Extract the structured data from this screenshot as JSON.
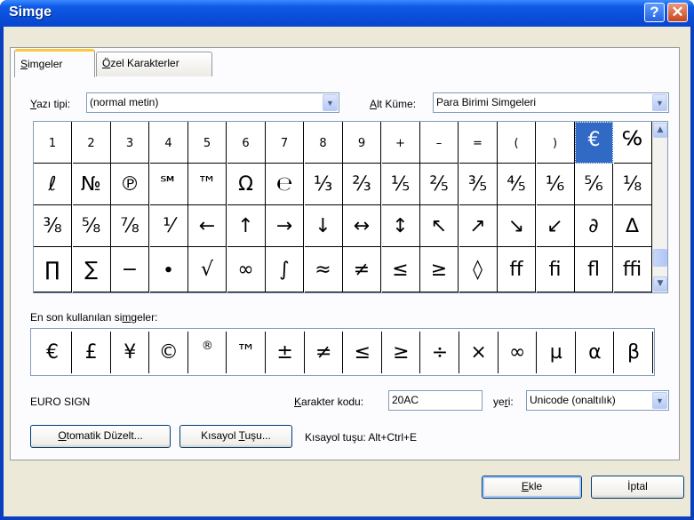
{
  "window": {
    "title": "Simge",
    "help_glyph": "?",
    "close_glyph": "✕"
  },
  "tabs": [
    {
      "label_ul": "S",
      "label_rest": "imgeler"
    },
    {
      "label_ul": "Ö",
      "label_rest": "zel Karakterler"
    }
  ],
  "font": {
    "label_ul": "Y",
    "label_rest": "azı tipi:",
    "value": "(normal metin)"
  },
  "subset": {
    "label_ul": "A",
    "label_rest": "lt Küme:",
    "value": "Para Birimi Simgeleri"
  },
  "symbols": [
    [
      "1",
      "2",
      "3",
      "4",
      "5",
      "6",
      "7",
      "8",
      "9",
      "+",
      "–",
      "=",
      "(",
      ")",
      "€",
      "℅"
    ],
    [
      "ℓ",
      "№",
      "℗",
      "℠",
      "™",
      "Ω",
      "℮",
      "⅓",
      "⅔",
      "⅕",
      "⅖",
      "⅗",
      "⅘",
      "⅙",
      "⅚",
      "⅛"
    ],
    [
      "⅜",
      "⅝",
      "⅞",
      "⅟",
      "←",
      "↑",
      "→",
      "↓",
      "↔",
      "↕",
      "↖",
      "↗",
      "↘",
      "↙",
      "∂",
      "∆"
    ],
    [
      "∏",
      "∑",
      "−",
      "∙",
      "√",
      "∞",
      "∫",
      "≈",
      "≠",
      "≤",
      "≥",
      "◊",
      "ﬀ",
      "ﬁ",
      "ﬂ",
      "ﬃ"
    ]
  ],
  "selected_symbol": {
    "row": 0,
    "col": 14
  },
  "recent_label": {
    "pre": "En son kullanılan si",
    "ul": "m",
    "post": "geler:"
  },
  "recent": [
    "€",
    "£",
    "¥",
    "©",
    "®",
    "™",
    "±",
    "≠",
    "≤",
    "≥",
    "÷",
    "×",
    "∞",
    "µ",
    "α",
    "β"
  ],
  "char_name": "EURO SIGN",
  "char_code": {
    "label_ul": "K",
    "label_rest": "arakter kodu:",
    "value": "20AC"
  },
  "from": {
    "label_pre": "ye",
    "label_ul": "r",
    "label_post": "i:",
    "value": "Unicode (onaltılık)"
  },
  "autocorrect_button": {
    "ul": "O",
    "rest": "tomatik Düzelt..."
  },
  "shortcut_button": {
    "pre": "Kısayol ",
    "ul": "T",
    "post": "uşu..."
  },
  "shortcut_text": "Kısayol tuşu: Alt+Ctrl+E",
  "insert_button": {
    "ul": "E",
    "rest": "kle"
  },
  "cancel_button": {
    "label": "İptal"
  }
}
